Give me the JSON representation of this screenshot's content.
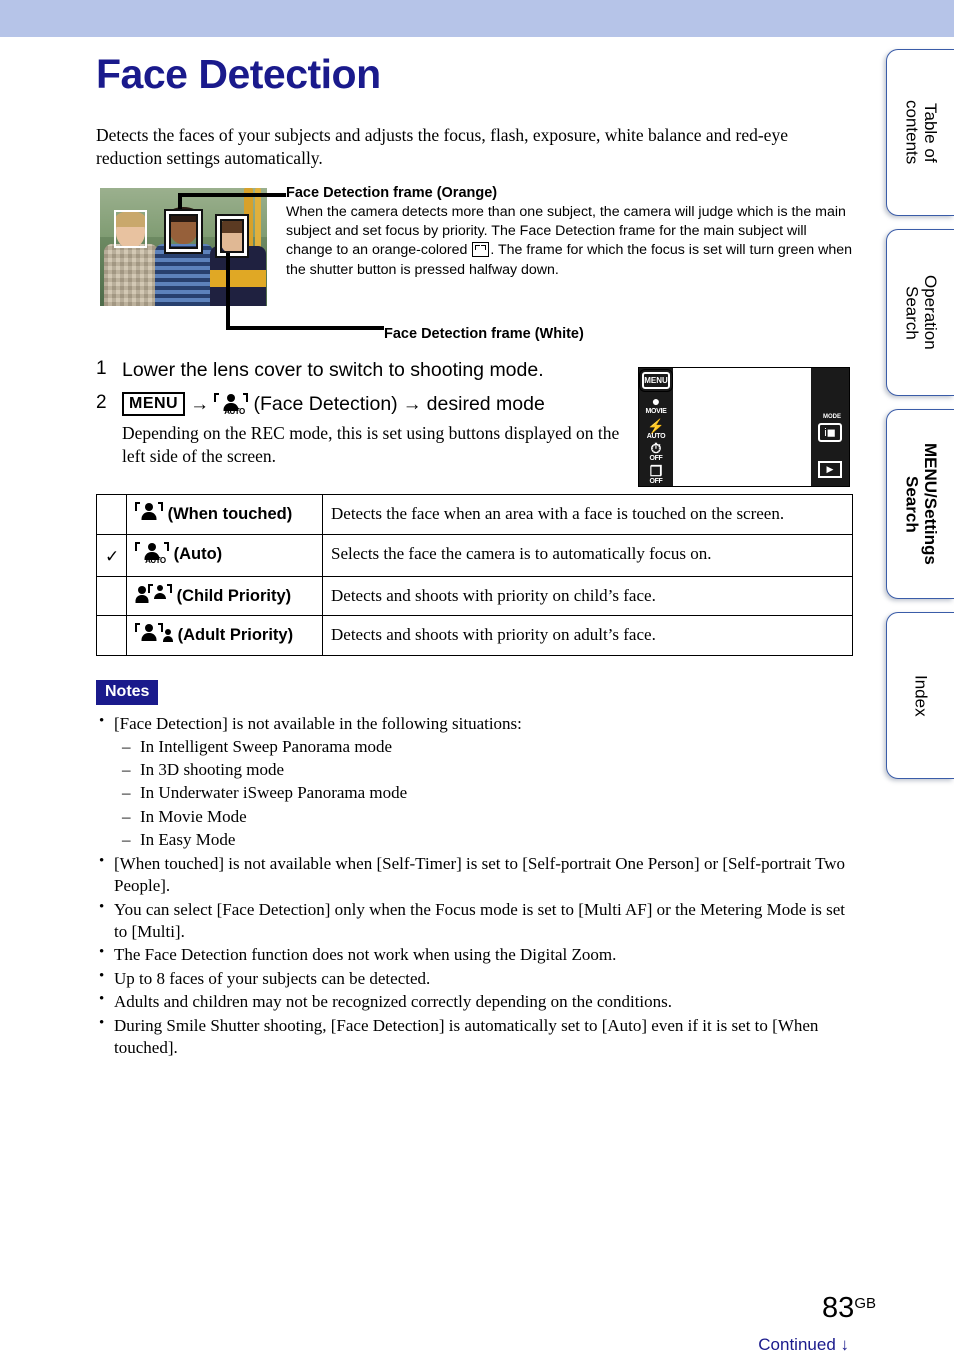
{
  "top_band_color": "#b6c4e8",
  "title_color": "#1a1a8c",
  "header": {
    "title": "Face Detection"
  },
  "intro": "Detects the faces of your subjects and adjusts the focus, flash, exposure, white balance and red-eye reduction settings automatically.",
  "figure": {
    "photo_alt": "Three children photographed with face detection frames",
    "callout_orange_title": "Face Detection frame (Orange)",
    "callout_orange_body_1": "When the camera detects more than one subject, the camera will judge which is the main subject and set focus by priority. The Face Detection frame for the main subject will change to an orange-colored ",
    "callout_orange_body_2": ". The frame for which the focus is set will turn green when the shutter button is pressed halfway down.",
    "callout_white_title": "Face Detection frame (White)"
  },
  "steps": [
    {
      "num": "1",
      "text": "Lower the lens cover to switch to shooting mode."
    },
    {
      "num": "2",
      "menu_chip": "MENU",
      "arrow": "→",
      "icon_label": "AUTO",
      "mid_text": "(Face Detection)",
      "end_text": "desired mode",
      "sub": "Depending on the REC mode, this is set using buttons displayed on the left side of the screen."
    }
  ],
  "camera_screen": {
    "menu_button": "MENU",
    "left_icons": [
      {
        "glyph": "●",
        "label": "MOVIE",
        "name": "movie-mode-icon"
      },
      {
        "glyph": "⚡",
        "label": "AUTO",
        "name": "flash-auto-icon"
      },
      {
        "glyph": "⏱",
        "label": "OFF",
        "name": "self-timer-icon"
      },
      {
        "glyph": "❐",
        "label": "OFF",
        "name": "burst-mode-icon"
      }
    ],
    "mode_label": "MODE",
    "mode_glyph": "i◼",
    "play_glyph": "▶"
  },
  "table": {
    "rows": [
      {
        "checked": false,
        "check_glyph": "",
        "icon": "face-when-touched-icon",
        "mode": "(When touched)",
        "desc": "Detects the face when an area with a face is touched on the screen."
      },
      {
        "checked": true,
        "check_glyph": "✓",
        "icon": "face-auto-icon",
        "mode": "(Auto)",
        "desc": "Selects the face the camera is to automatically focus on."
      },
      {
        "checked": false,
        "check_glyph": "",
        "icon": "face-child-priority-icon",
        "mode": "(Child Priority)",
        "desc": "Detects and shoots with priority on child’s face."
      },
      {
        "checked": false,
        "check_glyph": "",
        "icon": "face-adult-priority-icon",
        "mode": "(Adult Priority)",
        "desc": "Detects and shoots with priority on adult’s face."
      }
    ]
  },
  "notes": {
    "badge": "Notes",
    "items": [
      "[Face Detection] is not available in the following situations:",
      "[When touched] is not available when [Self-Timer] is set to [Self-portrait One Person] or [Self-portrait Two People].",
      "You can select [Face Detection] only when the Focus mode is set to [Multi AF] or the Metering Mode is set to [Multi].",
      "The Face Detection function does not work when using the Digital Zoom.",
      "Up to 8 faces of your subjects can be detected.",
      "Adults and children may not be recognized correctly depending on the conditions.",
      "During Smile Shutter shooting, [Face Detection] is automatically set to [Auto] even if it is set to [When touched]."
    ],
    "sub_items": [
      "In Intelligent Sweep Panorama mode",
      "In 3D shooting mode",
      "In Underwater iSweep Panorama mode",
      "In Movie Mode",
      "In Easy Mode"
    ]
  },
  "side_tabs": [
    {
      "label": "Table of\ncontents",
      "active": false
    },
    {
      "label": "Operation\nSearch",
      "active": false
    },
    {
      "label": "MENU/Settings\nSearch",
      "active": true
    },
    {
      "label": "Index",
      "active": false
    }
  ],
  "footer": {
    "page_number": "83",
    "page_suffix": "GB",
    "continued": "Continued ↓"
  }
}
